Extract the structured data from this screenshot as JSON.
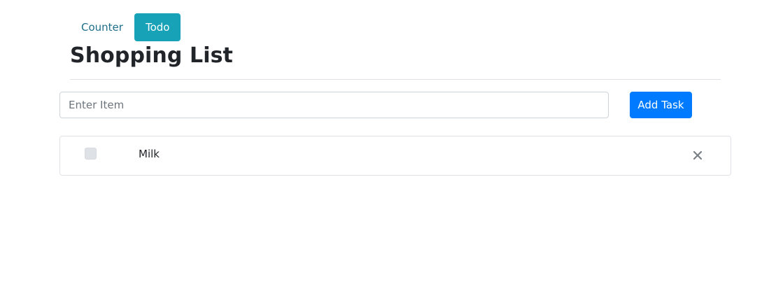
{
  "nav": {
    "tabs": [
      {
        "label": "Counter",
        "active": false
      },
      {
        "label": "Todo",
        "active": true
      }
    ]
  },
  "page": {
    "title": "Shopping List"
  },
  "form": {
    "input_value": "",
    "input_placeholder": "Enter Item",
    "add_button_label": "Add Task"
  },
  "list": {
    "items": [
      {
        "label": "Milk",
        "checked": false
      }
    ]
  },
  "colors": {
    "tab_active_bg": "#17a2b8",
    "primary_button": "#007bff",
    "checkbox_bg": "#dee2e6",
    "delete_icon": "#7a7f85"
  },
  "icons": {
    "delete": "close-icon",
    "checkbox": "checkbox-unchecked-icon"
  }
}
